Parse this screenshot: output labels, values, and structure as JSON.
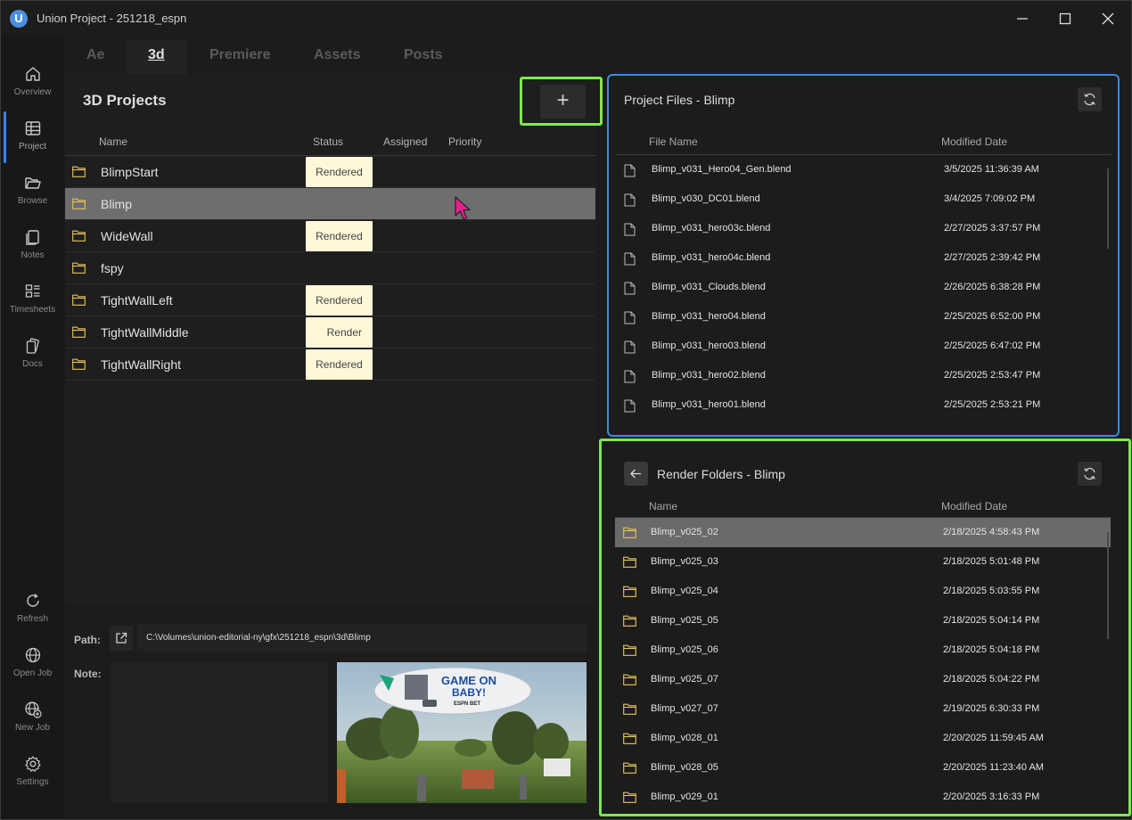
{
  "window": {
    "logo_letter": "U",
    "title": "Union Project - 251218_espn"
  },
  "sidebar": {
    "items": [
      {
        "label": "Overview",
        "icon": "home-icon"
      },
      {
        "label": "Project",
        "icon": "table-icon"
      },
      {
        "label": "Browse",
        "icon": "folder-open-icon"
      },
      {
        "label": "Notes",
        "icon": "notes-icon"
      },
      {
        "label": "Timesheets",
        "icon": "timesheets-icon"
      },
      {
        "label": "Docs",
        "icon": "docs-icon"
      },
      {
        "label": "Refresh",
        "icon": "refresh-icon"
      },
      {
        "label": "Open Job",
        "icon": "globe-icon"
      },
      {
        "label": "New Job",
        "icon": "globe-plus-icon"
      },
      {
        "label": "Settings",
        "icon": "gear-icon"
      }
    ],
    "active": "Project",
    "accent_color": "#3b82f6"
  },
  "tabs": {
    "items": [
      "Ae",
      "3d",
      "Premiere",
      "Assets",
      "Posts"
    ],
    "active": "3d"
  },
  "projects": {
    "title": "3D Projects",
    "add_label": "+",
    "columns": [
      "Name",
      "Status",
      "Assigned",
      "Priority"
    ],
    "rows": [
      {
        "name": "BlimpStart",
        "status": "Rendered"
      },
      {
        "name": "Blimp",
        "status": ""
      },
      {
        "name": "WideWall",
        "status": "Rendered"
      },
      {
        "name": "fspy",
        "status": ""
      },
      {
        "name": "TightWallLeft",
        "status": "Rendered"
      },
      {
        "name": "TightWallMiddle",
        "status": "Render"
      },
      {
        "name": "TightWallRight",
        "status": "Rendered"
      }
    ],
    "selected": "Blimp",
    "status_color": "#fff8d8"
  },
  "detail": {
    "path_label": "Path:",
    "path_value": "C:\\Volumes\\union-editorial-ny\\gfx\\251218_espn\\3d\\Blimp",
    "note_label": "Note:",
    "note_value": "",
    "preview_text_line1": "GAME ON",
    "preview_text_line2": "BABY!",
    "preview_brand": "ESPN BET"
  },
  "project_files": {
    "title": "Project Files - Blimp",
    "columns": [
      "File Name",
      "Modified Date"
    ],
    "rows": [
      {
        "name": "Blimp_v031_Hero04_Gen.blend",
        "date": "3/5/2025 11:36:39 AM"
      },
      {
        "name": "Blimp_v030_DC01.blend",
        "date": "3/4/2025 7:09:02 PM"
      },
      {
        "name": "Blimp_v031_hero03c.blend",
        "date": "2/27/2025 3:37:57 PM"
      },
      {
        "name": "Blimp_v031_hero04c.blend",
        "date": "2/27/2025 2:39:42 PM"
      },
      {
        "name": "Blimp_v031_Clouds.blend",
        "date": "2/26/2025 6:38:28 PM"
      },
      {
        "name": "Blimp_v031_hero04.blend",
        "date": "2/25/2025 6:52:00 PM"
      },
      {
        "name": "Blimp_v031_hero03.blend",
        "date": "2/25/2025 6:47:02 PM"
      },
      {
        "name": "Blimp_v031_hero02.blend",
        "date": "2/25/2025 2:53:47 PM"
      },
      {
        "name": "Blimp_v031_hero01.blend",
        "date": "2/25/2025 2:53:21 PM"
      }
    ],
    "border_color": "#3d8ae0"
  },
  "render_folders": {
    "title": "Render Folders - Blimp",
    "columns": [
      "Name",
      "Modified Date"
    ],
    "rows": [
      {
        "name": "Blimp_v025_02",
        "date": "2/18/2025 4:58:43 PM"
      },
      {
        "name": "Blimp_v025_03",
        "date": "2/18/2025 5:01:48 PM"
      },
      {
        "name": "Blimp_v025_04",
        "date": "2/18/2025 5:03:55 PM"
      },
      {
        "name": "Blimp_v025_05",
        "date": "2/18/2025 5:04:14 PM"
      },
      {
        "name": "Blimp_v025_06",
        "date": "2/18/2025 5:04:18 PM"
      },
      {
        "name": "Blimp_v025_07",
        "date": "2/18/2025 5:04:22 PM"
      },
      {
        "name": "Blimp_v027_07",
        "date": "2/19/2025 6:30:33 PM"
      },
      {
        "name": "Blimp_v028_01",
        "date": "2/20/2025 11:59:45 AM"
      },
      {
        "name": "Blimp_v028_05",
        "date": "2/20/2025 11:23:40 AM"
      },
      {
        "name": "Blimp_v029_01",
        "date": "2/20/2025 3:16:33 PM"
      }
    ],
    "selected": "Blimp_v025_02",
    "highlight_color": "#7ee84e"
  }
}
